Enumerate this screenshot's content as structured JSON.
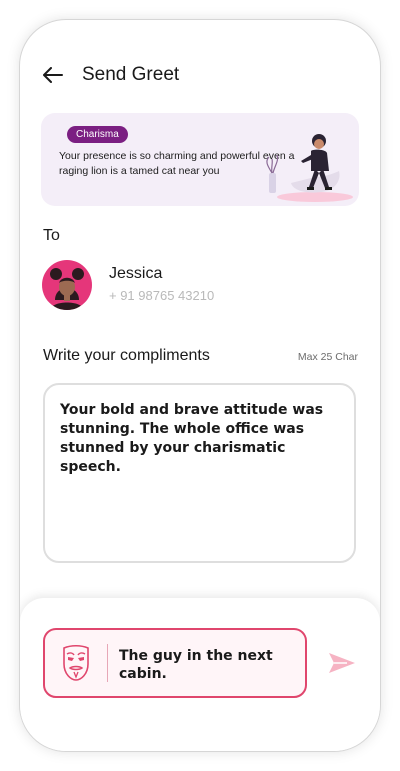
{
  "header": {
    "title": "Send Greet"
  },
  "banner": {
    "tag": "Charisma",
    "message": "Your presence is so charming and powerful even a raging lion is a tamed cat near you"
  },
  "recipient": {
    "section_label": "To",
    "name": "Jessica",
    "phone": "+ 91 98765 43210"
  },
  "compliment": {
    "label": "Write your compliments",
    "limit": "Max 25 Char",
    "text": "Your bold and brave attitude was stunning. The whole office was stunned by your charismatic speech."
  },
  "sender": {
    "hint": "The guy in the next cabin."
  },
  "colors": {
    "accent": "#e0466d",
    "tag": "#7b1f82",
    "banner_bg": "#f4eef8",
    "send_icon": "#f6b3c3"
  },
  "icons": {
    "back": "arrow-left-icon",
    "sender": "anonymous-mask-icon",
    "send": "send-icon"
  }
}
